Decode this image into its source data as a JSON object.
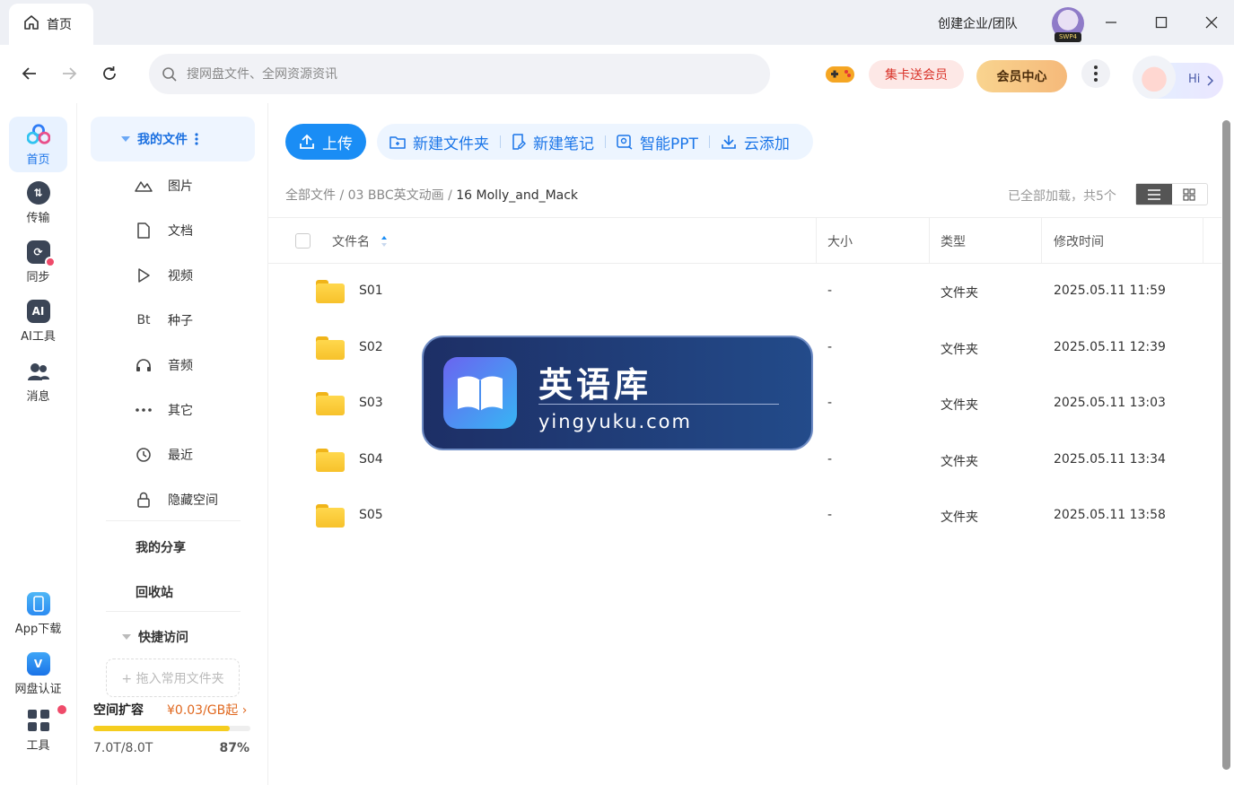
{
  "titlebar": {
    "tab_label": "首页",
    "corp_label": "创建企业/团队",
    "avatar_badge": "SWP4"
  },
  "nav": {
    "search_placeholder": "搜网盘文件、全网资源资讯",
    "card_promo": "集卡送会员",
    "vip_center": "会员中心",
    "hi_label": "Hi"
  },
  "rail": {
    "items": [
      {
        "label": "首页",
        "icon": "home-cloud-icon"
      },
      {
        "label": "传输",
        "icon": "transfer-icon"
      },
      {
        "label": "同步",
        "icon": "sync-icon"
      },
      {
        "label": "AI工具",
        "icon": "ai-tool-icon"
      },
      {
        "label": "消息",
        "icon": "message-icon"
      },
      {
        "label": "App下载",
        "icon": "phone-icon"
      },
      {
        "label": "网盘认证",
        "icon": "verify-icon"
      },
      {
        "label": "工具",
        "icon": "tools-grid-icon"
      }
    ]
  },
  "sidebar": {
    "my_files": "我的文件",
    "categories": [
      {
        "label": "图片",
        "icon": "image-icon"
      },
      {
        "label": "文档",
        "icon": "document-icon"
      },
      {
        "label": "视频",
        "icon": "video-icon"
      },
      {
        "label": "种子",
        "icon": "torrent-icon"
      },
      {
        "label": "音频",
        "icon": "audio-icon"
      },
      {
        "label": "其它",
        "icon": "more-dots-icon"
      },
      {
        "label": "最近",
        "icon": "recent-icon"
      },
      {
        "label": "隐藏空间",
        "icon": "lock-icon"
      }
    ],
    "my_share": "我的分享",
    "recycle": "回收站",
    "quick_access": "快捷访问",
    "drop_hint": "+ 拖入常用文件夹",
    "capacity_title": "空间扩容",
    "capacity_price": "¥0.03/GB起",
    "capacity_used": "7.0T/8.0T",
    "capacity_pct": "87%",
    "capacity_fraction": 0.87
  },
  "toolbar": {
    "upload": "上传",
    "actions": [
      {
        "label": "新建文件夹",
        "icon": "new-folder-icon"
      },
      {
        "label": "新建笔记",
        "icon": "new-note-icon"
      },
      {
        "label": "智能PPT",
        "icon": "smart-ppt-icon"
      },
      {
        "label": "云添加",
        "icon": "cloud-add-icon"
      }
    ]
  },
  "breadcrumb": {
    "root": "全部文件",
    "sep": " / ",
    "middle": "03 BBC英文动画",
    "current": "16 Molly_and_Mack",
    "status": "已全部加载，共5个"
  },
  "table": {
    "headers": {
      "name": "文件名",
      "size": "大小",
      "type": "类型",
      "modified": "修改时间"
    },
    "rows": [
      {
        "name": "S01",
        "size": "-",
        "type": "文件夹",
        "modified": "2025.05.11 11:59"
      },
      {
        "name": "S02",
        "size": "-",
        "type": "文件夹",
        "modified": "2025.05.11 12:39"
      },
      {
        "name": "S03",
        "size": "-",
        "type": "文件夹",
        "modified": "2025.05.11 13:03"
      },
      {
        "name": "S04",
        "size": "-",
        "type": "文件夹",
        "modified": "2025.05.11 13:34"
      },
      {
        "name": "S05",
        "size": "-",
        "type": "文件夹",
        "modified": "2025.05.11 13:58"
      }
    ]
  },
  "watermark": {
    "title": "英语库",
    "url": "yingyuku.com"
  },
  "colors": {
    "accent": "#1a8df5",
    "active_bg": "#eef5ff",
    "folder": "#f7c22b",
    "capacity_fill": "#f5cd1f",
    "watermark_bg": "#1d2f66"
  }
}
